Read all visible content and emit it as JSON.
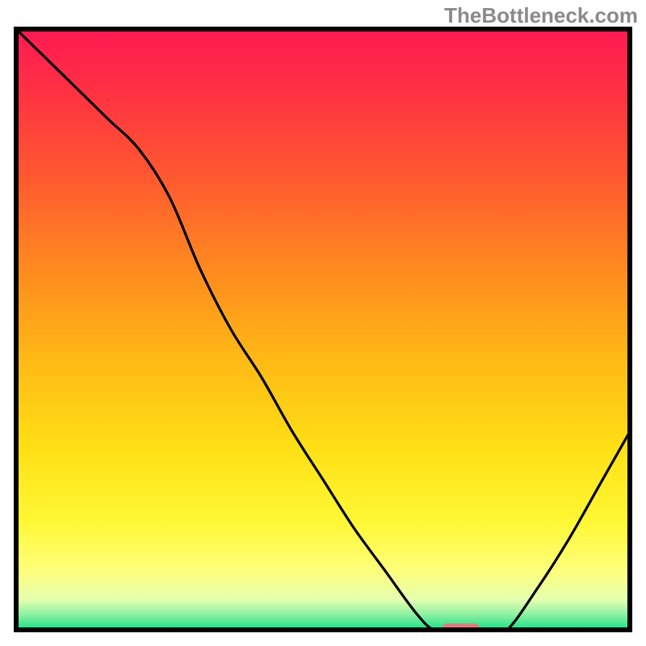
{
  "watermark": "TheBottleneck.com",
  "chart_data": {
    "type": "line",
    "title": "",
    "xlabel": "",
    "ylabel": "",
    "xlim": [
      0,
      100
    ],
    "ylim": [
      0,
      100
    ],
    "x": [
      0,
      5,
      10,
      15,
      20,
      25,
      30,
      35,
      40,
      45,
      50,
      55,
      60,
      65,
      68,
      71,
      74,
      77,
      80,
      85,
      90,
      95,
      100
    ],
    "values": [
      100,
      95,
      90,
      85,
      80,
      72,
      60,
      50,
      42,
      33,
      25,
      17,
      10,
      3,
      0,
      0,
      0,
      0,
      0,
      7,
      15,
      24,
      33
    ],
    "background_gradient": {
      "stops": [
        {
          "offset": 0.0,
          "color": "#ff1a53"
        },
        {
          "offset": 0.1,
          "color": "#ff3043"
        },
        {
          "offset": 0.25,
          "color": "#ff5a2f"
        },
        {
          "offset": 0.4,
          "color": "#ff8a1f"
        },
        {
          "offset": 0.55,
          "color": "#ffb915"
        },
        {
          "offset": 0.7,
          "color": "#ffe015"
        },
        {
          "offset": 0.82,
          "color": "#fff835"
        },
        {
          "offset": 0.9,
          "color": "#ffff7a"
        },
        {
          "offset": 0.95,
          "color": "#e5ffb0"
        },
        {
          "offset": 0.975,
          "color": "#8cf0a2"
        },
        {
          "offset": 1.0,
          "color": "#15e085"
        }
      ]
    },
    "marker": {
      "x": 72.5,
      "y": 0,
      "color": "#e07a7a",
      "width": 6,
      "height": 1.2
    }
  }
}
